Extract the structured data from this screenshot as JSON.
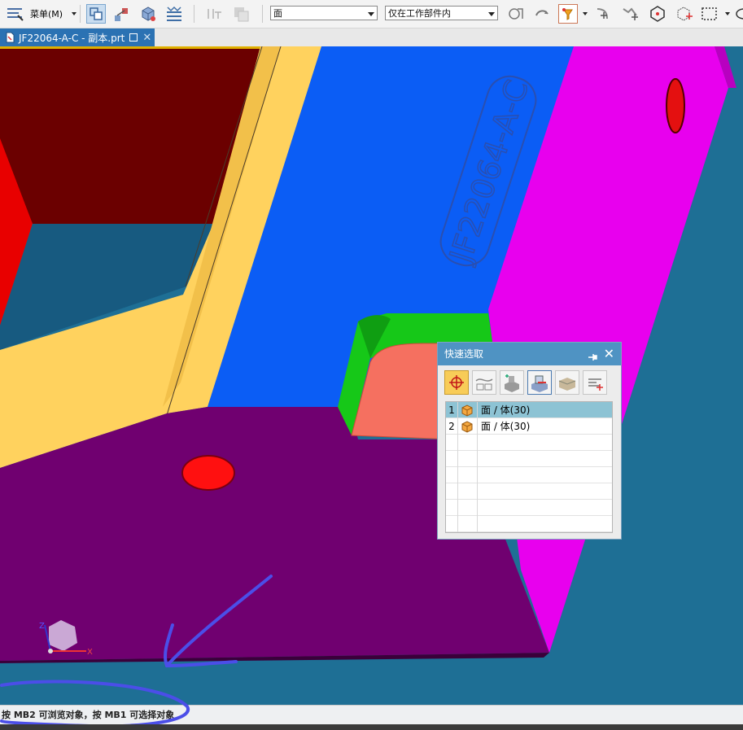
{
  "toolbar": {
    "menu_label": "菜单(M)",
    "filter_type": "面",
    "filter_scope": "仅在工作部件内"
  },
  "tab": {
    "title": "JF22064-A-C - 副本.prt"
  },
  "model": {
    "engraved_text": "JF22064-A-C",
    "axis_x": "X",
    "axis_z": "Z"
  },
  "quick_pick": {
    "title": "快速选取",
    "rows": [
      {
        "index": "1",
        "label": "面 / 体(30)",
        "selected": true
      },
      {
        "index": "2",
        "label": "面 / 体(30)",
        "selected": false
      }
    ]
  },
  "status": {
    "text": "按 MB2 可浏览对象，按 MB1 可选择对象"
  },
  "colors": {
    "accent": "#2b72b3",
    "dialog_title": "#4f93c3",
    "selected_row": "#8dc3d4"
  }
}
